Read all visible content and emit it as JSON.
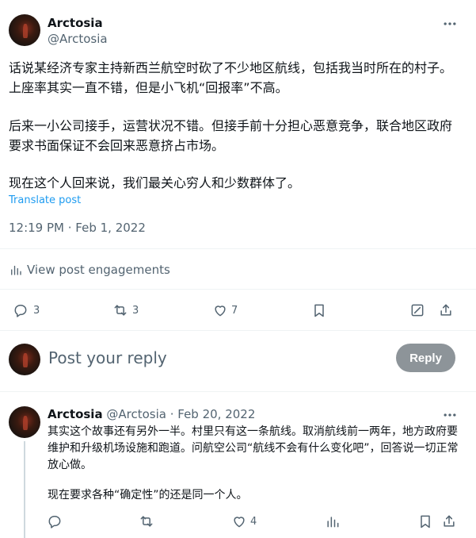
{
  "main_post": {
    "author_name": "Arctosia",
    "author_handle": "@Arctosia",
    "paragraphs": [
      "话说某经济专家主持新西兰航空时砍了不少地区航线，包括我当时所在的村子。上座率其实一直不错，但是小飞机“回报率”不高。",
      "后来一小公司接手，运营状况不错。但接手前十分担心恶意竞争，联合地区政府要求书面保证不会回来恶意挤占市场。",
      "现在这个人回来说，我们最关心穷人和少数群体了。"
    ],
    "translate_label": "Translate post",
    "timestamp": "12:19 PM · Feb 1, 2022",
    "engagements_label": "View post engagements",
    "replies_count": "3",
    "reposts_count": "3",
    "likes_count": "7"
  },
  "reply_composer": {
    "placeholder": "Post your reply",
    "button_label": "Reply"
  },
  "reply_post": {
    "author_name": "Arctosia",
    "author_handle": "@Arctosia",
    "date": "· Feb 20, 2022",
    "paragraphs": [
      "其实这个故事还有另外一半。村里只有这一条航线。取消航线前一两年，地方政府要维护和升级机场设施和跑道。问航空公司“航线不会有什么变化吧”，回答说一切正常放心做。",
      "现在要求各种“确定性”的还是同一个人。"
    ],
    "likes_count": "4"
  },
  "colors": {
    "accent": "#1d9bf0",
    "muted": "#536471",
    "reply_button_bg": "#8d9499"
  }
}
